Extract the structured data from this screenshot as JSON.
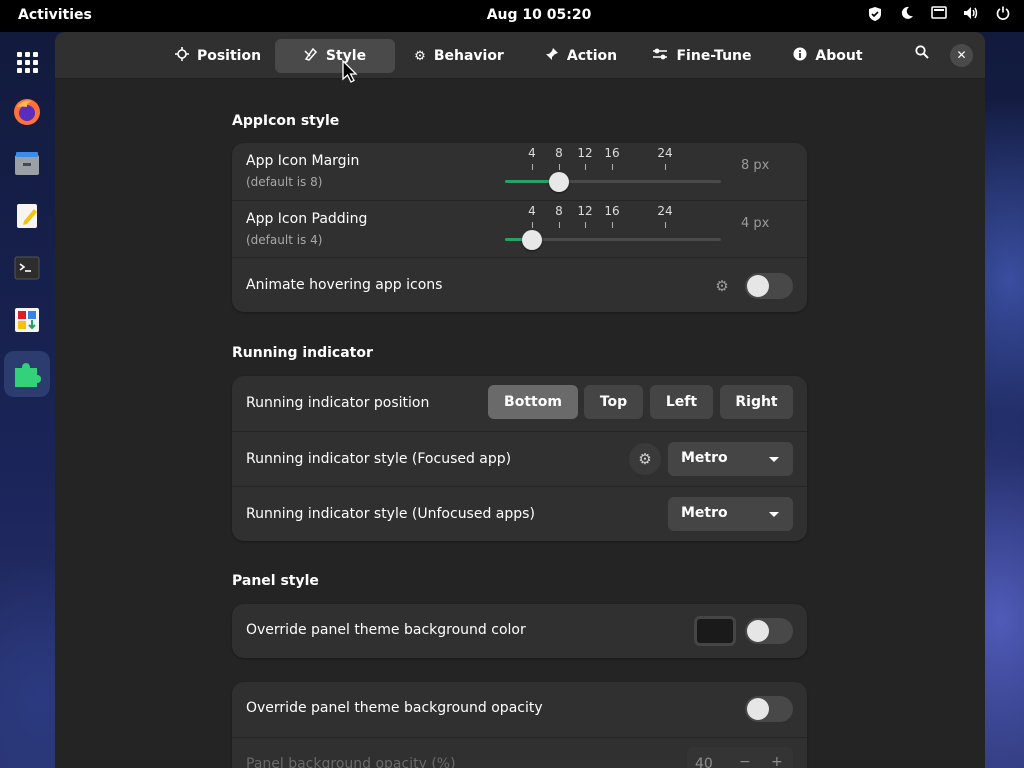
{
  "topbar": {
    "activities": "Activities",
    "clock": "Aug 10  05:20",
    "tray": [
      "shield-icon",
      "night-light-icon",
      "screen-icon",
      "volume-icon",
      "power-icon"
    ]
  },
  "dash": {
    "apps": [
      "app-grid",
      "firefox",
      "files",
      "text-editor",
      "terminal",
      "software",
      "extensions"
    ],
    "active_app": "extensions"
  },
  "headerbar": {
    "tabs": [
      {
        "label": "Position",
        "icon": "position-icon"
      },
      {
        "label": "Style",
        "icon": "style-icon",
        "selected": true
      },
      {
        "label": "Behavior",
        "icon": "gear-icon"
      },
      {
        "label": "Action",
        "icon": "pin-icon"
      },
      {
        "label": "Fine-Tune",
        "icon": "tune-icon"
      },
      {
        "label": "About",
        "icon": "info-icon"
      }
    ]
  },
  "appicon_style": {
    "title": "AppIcon style",
    "margin": {
      "label": "App Icon Margin",
      "sub": "(default is 8)",
      "marks": [
        "4",
        "8",
        "12",
        "16",
        "24"
      ],
      "value": 8,
      "value_text": "8 px"
    },
    "padding": {
      "label": "App Icon Padding",
      "sub": "(default is 4)",
      "marks": [
        "4",
        "8",
        "12",
        "16",
        "24"
      ],
      "value": 4,
      "value_text": "4 px"
    },
    "animate": {
      "label": "Animate hovering app icons",
      "enabled": false
    }
  },
  "running_indicator": {
    "title": "Running indicator",
    "position": {
      "label": "Running indicator position",
      "options": [
        "Bottom",
        "Top",
        "Left",
        "Right"
      ],
      "selected": "Bottom"
    },
    "focused": {
      "label": "Running indicator style (Focused app)",
      "value": "Metro"
    },
    "unfocused": {
      "label": "Running indicator style (Unfocused apps)",
      "value": "Metro"
    }
  },
  "panel_style": {
    "title": "Panel style",
    "override_color": {
      "label": "Override panel theme background color",
      "enabled": false,
      "color": "#1a1a1a"
    },
    "override_opacity": {
      "label": "Override panel theme background opacity",
      "enabled": false
    },
    "opacity_row": {
      "label": "Panel background opacity (%)",
      "value": "40",
      "minus": "−",
      "plus": "+"
    }
  },
  "colors": {
    "accent": "#26a269",
    "window_bg": "#242424",
    "card_bg": "#303030"
  }
}
